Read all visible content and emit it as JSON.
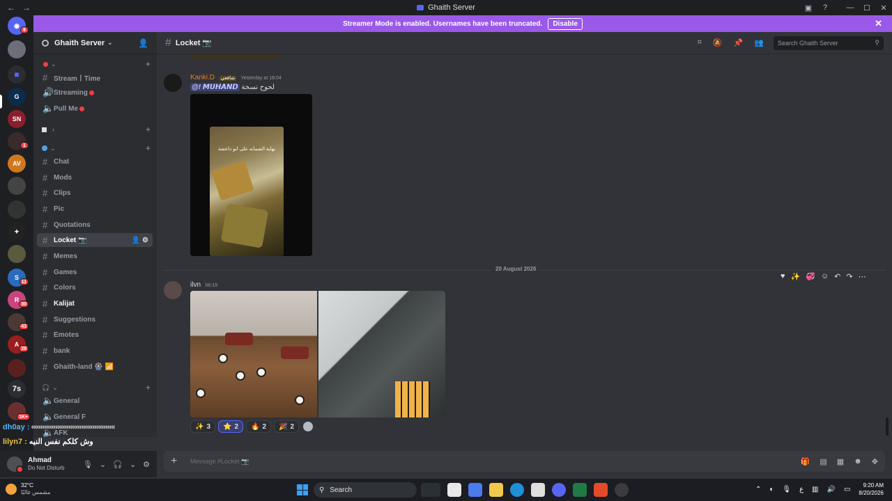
{
  "window": {
    "title": "Ghaith Server"
  },
  "banner": {
    "text": "Streamer Mode is enabled. Usernames have been truncated.",
    "button": "Disable"
  },
  "server_list": {
    "badges": [
      "8",
      "1",
      "11",
      "30",
      "43",
      "28",
      "1K+"
    ],
    "text_icon": "7s"
  },
  "sidebar": {
    "guild_name": "Ghaith Server",
    "channels": [
      {
        "label": "Stream丨Time"
      },
      {
        "label": "Streaming"
      },
      {
        "label": "Pull Me"
      },
      {
        "label": "Chat"
      },
      {
        "label": "Mods"
      },
      {
        "label": "Clips"
      },
      {
        "label": "Pic"
      },
      {
        "label": "Quotations"
      },
      {
        "label": "Locket 📷"
      },
      {
        "label": "Memes"
      },
      {
        "label": "Games"
      },
      {
        "label": "Colors"
      },
      {
        "label": "Kalijat"
      },
      {
        "label": "Suggestions"
      },
      {
        "label": "Emotes"
      },
      {
        "label": "bank"
      },
      {
        "label": "Ghaith-land 🎡 📶"
      },
      {
        "label": "General"
      },
      {
        "label": "General F"
      },
      {
        "label": "AFK"
      }
    ]
  },
  "user_panel": {
    "name": "Ahmad",
    "status": "Do Not Disturb"
  },
  "overlay_chat": {
    "line1_user": "dh0ay :",
    "line2_user": "lilyn7 :",
    "line2_text": "وش كلكم نفس النيه"
  },
  "channel_header": {
    "name": "Locket 📷",
    "search_placeholder": "Search Ghaith Server"
  },
  "messages": [
    {
      "author": "Kanki.D",
      "tag": "شافعي",
      "timestamp": "Yesterday at 18:04",
      "mention": "@! 𝙈𝙐𝙃𝘼𝙉𝘿",
      "text": "لحوح نسخة",
      "image_caption": "نهاية الشمانه على ابو داعشة"
    },
    {
      "author": "ilvn",
      "timestamp": "06:19"
    }
  ],
  "date_divider": "20 August 2026",
  "reactions": [
    {
      "emoji": "✨",
      "count": "3"
    },
    {
      "emoji": "⭐",
      "count": "2"
    },
    {
      "emoji": "🔥",
      "count": "2"
    },
    {
      "emoji": "🎉",
      "count": "2"
    }
  ],
  "composer": {
    "placeholder": "Message #Locket 📷"
  },
  "taskbar": {
    "weather_temp": "32°C",
    "weather_desc": "مشمس غالبًا",
    "search": "Search",
    "time": "9:20 AM",
    "date": "8/20/2026",
    "lang": "ع"
  },
  "colors": {
    "accent": "#5865f2",
    "banner": "#9b59e8",
    "dnd": "#f23f43",
    "author_orange": "#e67e22"
  }
}
